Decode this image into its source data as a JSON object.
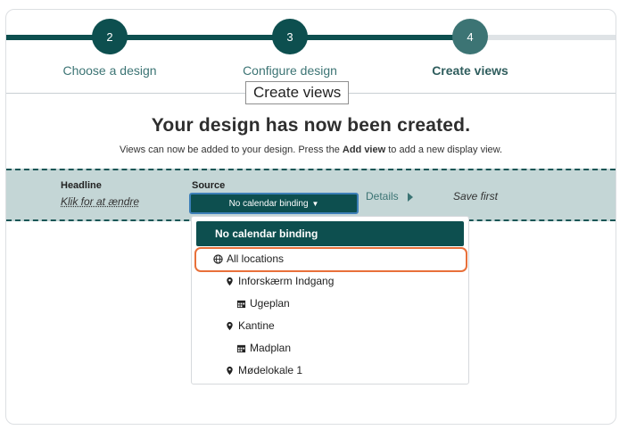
{
  "stepper": {
    "steps": [
      {
        "number": "2",
        "label": "Choose a design"
      },
      {
        "number": "3",
        "label": "Configure design"
      },
      {
        "number": "4",
        "label": "Create views"
      }
    ]
  },
  "tooltip": "Create views",
  "header": {
    "title": "Your design has now been created.",
    "subtitle_pre": "Views can now be added to your design. Press the ",
    "subtitle_bold": "Add view",
    "subtitle_post": " to add a new display view."
  },
  "view_row": {
    "headline_label": "Headline",
    "headline_value": "Klik for at ændre",
    "source_label": "Source",
    "source_value": "No calendar binding",
    "details_label": "Details",
    "save_label": "Save first"
  },
  "dropdown": {
    "selected": "No calendar binding",
    "items": [
      {
        "label": "All locations",
        "icon": "globe-icon"
      },
      {
        "label": "Inforskærm Indgang",
        "icon": "map-marker-icon"
      },
      {
        "label": "Ugeplan",
        "icon": "calendar-icon"
      },
      {
        "label": "Kantine",
        "icon": "map-marker-icon"
      },
      {
        "label": "Madplan",
        "icon": "calendar-icon"
      },
      {
        "label": "Mødelokale 1",
        "icon": "map-marker-icon"
      }
    ]
  },
  "colors": {
    "primary": "#0d4f4f",
    "accent": "#3c7474",
    "highlight": "#e8703a",
    "row_bg": "#c4d6d6"
  }
}
